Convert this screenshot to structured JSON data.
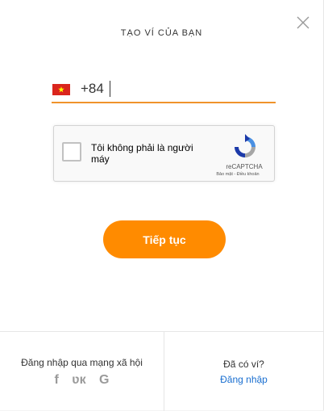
{
  "header": {
    "title": "TẠO VÍ CỦA BẠN",
    "close_icon": "close-icon"
  },
  "phone": {
    "country_flag": "vietnam-flag-icon",
    "value": "+84",
    "underline_color": "#f0932b"
  },
  "recaptcha": {
    "label": "Tôi không phải là người máy",
    "brand": "reCAPTCHA",
    "links": "Bảo mật - Điều khoản"
  },
  "actions": {
    "continue_label": "Tiếp tục",
    "continue_color": "#ff8b00"
  },
  "footer": {
    "social_label": "Đăng nhập qua mạng xã hội",
    "social_icons": [
      "facebook-icon",
      "vk-icon",
      "google-icon"
    ],
    "social_glyphs": [
      "f",
      "ʋк",
      "G"
    ],
    "have_wallet": "Đã có ví?",
    "login_label": "Đăng nhập",
    "link_color": "#1a6fd0"
  }
}
